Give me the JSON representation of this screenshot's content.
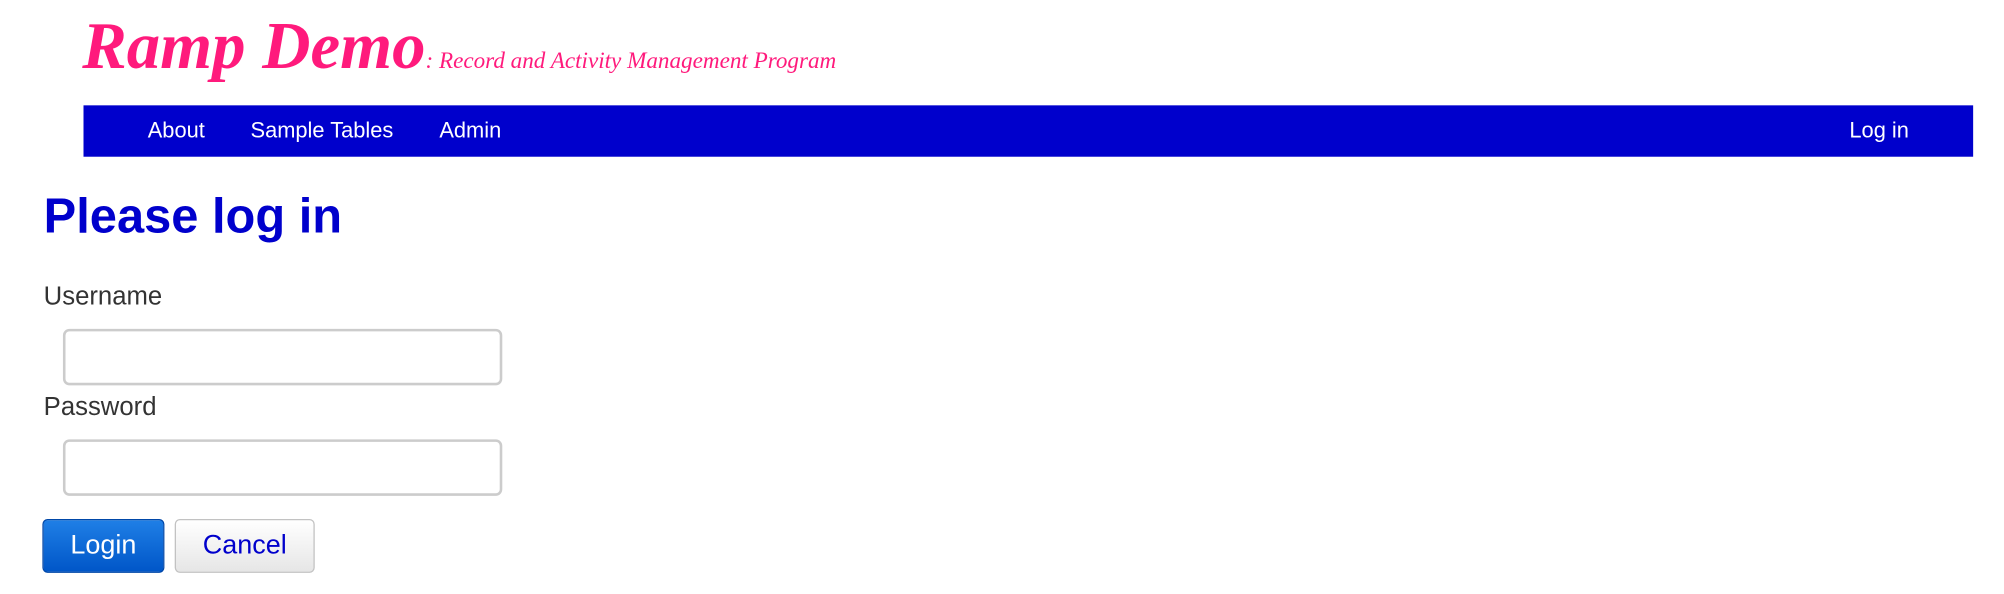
{
  "brand": {
    "title": "Ramp Demo",
    "subtitle": ": Record and Activity Management Program"
  },
  "navbar": {
    "items": [
      {
        "label": "About"
      },
      {
        "label": "Sample Tables"
      },
      {
        "label": "Admin"
      }
    ],
    "login_label": "Log in"
  },
  "main": {
    "title": "Please log in",
    "username": {
      "label": "Username",
      "value": "",
      "placeholder": ""
    },
    "password": {
      "label": "Password",
      "value": "",
      "placeholder": ""
    },
    "login_button": "Login",
    "cancel_button": "Cancel"
  },
  "colors": {
    "brand": "#ff1a7c",
    "navbar_bg": "#0000cc",
    "title": "#0000cc",
    "primary_button": "#0062d6"
  }
}
